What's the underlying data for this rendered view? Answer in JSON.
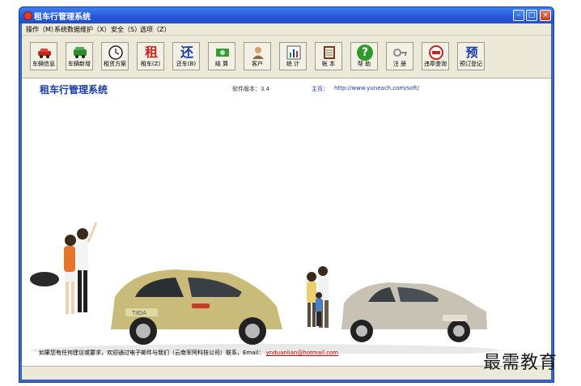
{
  "window": {
    "title": "租车行管理系统"
  },
  "menu": [
    "操作（M）",
    "系统数据维护（X）",
    "安全（S）",
    "选项（Z）"
  ],
  "toolbar": [
    {
      "label": "车辆信息",
      "icon": "red-car-icon"
    },
    {
      "label": "车辆新增",
      "icon": "green-car-icon"
    },
    {
      "label": "租赁方案",
      "icon": "clock-icon"
    },
    {
      "label": "租车(Z)",
      "icon": "rent-char-icon",
      "glyph": "租"
    },
    {
      "label": "还车(B)",
      "icon": "return-char-icon",
      "glyph": "还"
    },
    {
      "label": "结 算",
      "icon": "money-icon"
    },
    {
      "label": "客户",
      "icon": "customer-icon"
    },
    {
      "label": "统 计",
      "icon": "chart-icon"
    },
    {
      "label": "帐 本",
      "icon": "ledger-icon"
    },
    {
      "label": "帮 助",
      "icon": "help-icon",
      "glyph": "?"
    },
    {
      "label": "注 册",
      "icon": "key-icon"
    },
    {
      "label": "违章查询",
      "icon": "no-entry-icon"
    },
    {
      "label": "预订登记",
      "icon": "reserve-char-icon",
      "glyph": "预"
    }
  ],
  "content": {
    "app_title": "租车行管理系统",
    "version_label": "软件版本：3.4",
    "home_label": "主页：",
    "home_url": "http://www.yuneach.com/soft/",
    "footer_text": "如果您有任何建议或要求，欢迎通过电子邮件与我们（云南军阿科技公司）联系，Email：",
    "footer_email": "ynduanlian@hotmail.com",
    "car_badge": "TIIDA"
  },
  "watermark": "最需教育",
  "colors": {
    "titlebar": "#2657d8",
    "accent": "#1a3aa8",
    "chrome": "#ece9d8"
  }
}
